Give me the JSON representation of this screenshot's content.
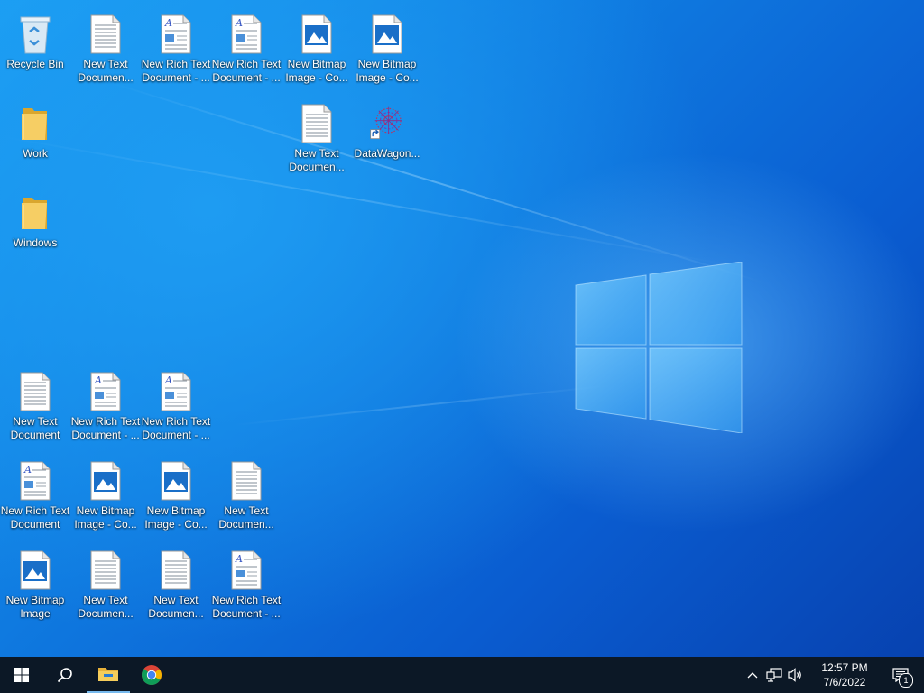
{
  "desktop": {
    "icons": [
      {
        "type": "recycle",
        "line1": "Recycle Bin",
        "line2": ""
      },
      {
        "type": "text",
        "line1": "New Text",
        "line2": "Documen..."
      },
      {
        "type": "rtf",
        "line1": "New Rich Text",
        "line2": "Document - ..."
      },
      {
        "type": "rtf",
        "line1": "New Rich Text",
        "line2": "Document - ..."
      },
      {
        "type": "bitmap",
        "line1": "New Bitmap",
        "line2": "Image - Co..."
      },
      {
        "type": "bitmap",
        "line1": "New Bitmap",
        "line2": "Image - Co..."
      },
      {
        "type": "folder",
        "line1": "Work",
        "line2": ""
      },
      {
        "type": "text",
        "line1": "New Text",
        "line2": "Documen..."
      },
      {
        "type": "shortcut",
        "line1": "DataWagon...",
        "line2": ""
      },
      {
        "type": "folder",
        "line1": "Windows",
        "line2": ""
      },
      {
        "type": "text",
        "line1": "New Text",
        "line2": "Document"
      },
      {
        "type": "rtf",
        "line1": "New Rich Text",
        "line2": "Document - ..."
      },
      {
        "type": "rtf",
        "line1": "New Rich Text",
        "line2": "Document - ..."
      },
      {
        "type": "rtf",
        "line1": "New Rich Text",
        "line2": "Document"
      },
      {
        "type": "bitmap",
        "line1": "New Bitmap",
        "line2": "Image - Co..."
      },
      {
        "type": "bitmap",
        "line1": "New Bitmap",
        "line2": "Image - Co..."
      },
      {
        "type": "text",
        "line1": "New Text",
        "line2": "Documen..."
      },
      {
        "type": "bitmap",
        "line1": "New Bitmap",
        "line2": "Image"
      },
      {
        "type": "text",
        "line1": "New Text",
        "line2": "Documen..."
      },
      {
        "type": "text",
        "line1": "New Text",
        "line2": "Documen..."
      },
      {
        "type": "rtf",
        "line1": "New Rich Text",
        "line2": "Document - ..."
      }
    ]
  },
  "taskbar": {
    "buttons": [
      {
        "name": "start-button",
        "icon": "windows-logo-icon"
      },
      {
        "name": "search-button",
        "icon": "search-icon"
      },
      {
        "name": "file-explorer-button",
        "icon": "folder-icon"
      },
      {
        "name": "chrome-button",
        "icon": "chrome-icon"
      }
    ],
    "tray": {
      "icons": [
        "chevron-up-icon",
        "network-icon",
        "volume-icon"
      ],
      "time": "12:57 PM",
      "date": "7/6/2022",
      "notification_count": "1"
    }
  },
  "colors": {
    "taskbar_bg": "#0c1826",
    "accent": "#76b9ed",
    "desktop_blue": "#0f7ae0"
  }
}
